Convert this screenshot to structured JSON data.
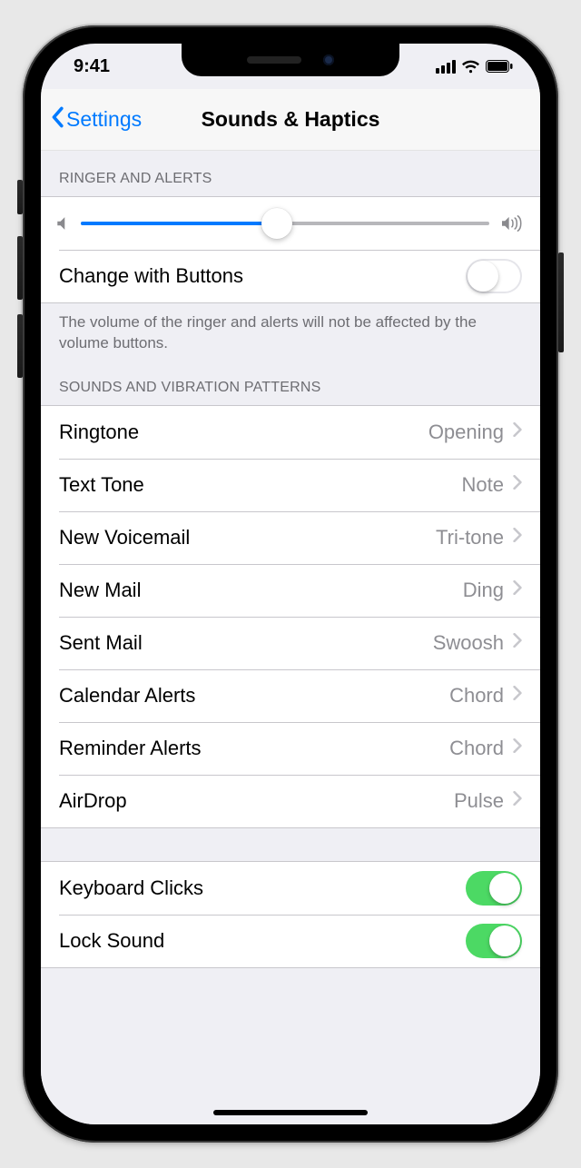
{
  "status": {
    "time": "9:41"
  },
  "nav": {
    "back_label": "Settings",
    "title": "Sounds & Haptics"
  },
  "ringer": {
    "header": "Ringer and Alerts",
    "volume_percent": 48,
    "change_with_buttons": {
      "label": "Change with Buttons",
      "on": false
    },
    "footer": "The volume of the ringer and alerts will not be affected by the volume buttons."
  },
  "patterns": {
    "header": "Sounds and Vibration Patterns",
    "items": [
      {
        "label": "Ringtone",
        "value": "Opening"
      },
      {
        "label": "Text Tone",
        "value": "Note"
      },
      {
        "label": "New Voicemail",
        "value": "Tri-tone"
      },
      {
        "label": "New Mail",
        "value": "Ding"
      },
      {
        "label": "Sent Mail",
        "value": "Swoosh"
      },
      {
        "label": "Calendar Alerts",
        "value": "Chord"
      },
      {
        "label": "Reminder Alerts",
        "value": "Chord"
      },
      {
        "label": "AirDrop",
        "value": "Pulse"
      }
    ]
  },
  "system_sounds": {
    "items": [
      {
        "label": "Keyboard Clicks",
        "on": true
      },
      {
        "label": "Lock Sound",
        "on": true
      }
    ]
  }
}
